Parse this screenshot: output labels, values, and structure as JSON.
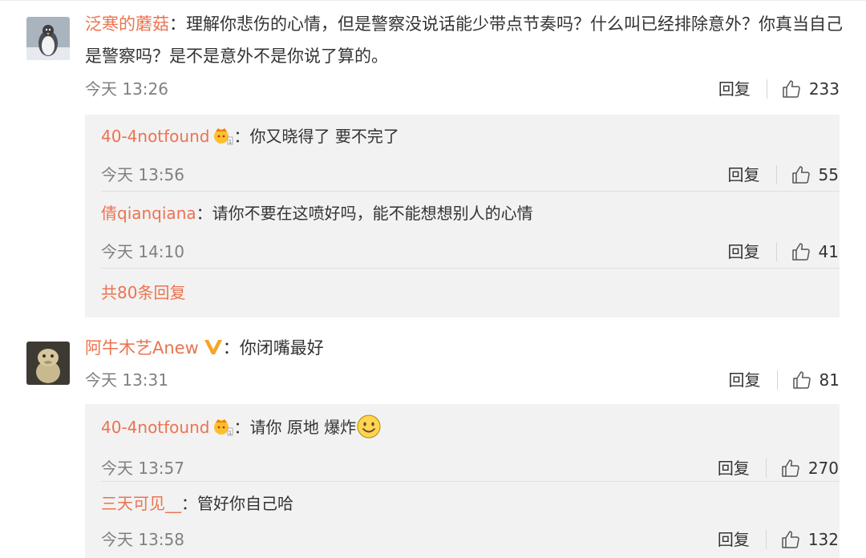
{
  "comments": [
    {
      "user": "泛寒的蘑菇",
      "text": "理解你悲伤的心情，但是警察没说话能少带点节奏吗？什么叫已经排除意外？你真当自己是警察吗？是不是意外不是你说了算的。",
      "time": "今天 13:26",
      "reply_label": "回复",
      "likes": "233",
      "replies": [
        {
          "user": "40-4notfound",
          "text": "你又晓得了 要不完了",
          "time": "今天 13:56",
          "reply_label": "回复",
          "likes": "55"
        },
        {
          "user": "倩qianqiana",
          "text": "请你不要在这喷好吗，能不能想想别人的心情",
          "time": "今天 14:10",
          "reply_label": "回复",
          "likes": "41"
        }
      ],
      "more_replies": "共80条回复"
    },
    {
      "user": "阿牛木艺Anew",
      "text": "你闭嘴最好",
      "time": "今天 13:31",
      "reply_label": "回复",
      "likes": "81",
      "replies": [
        {
          "user": "40-4notfound",
          "text": "请你 原地 爆炸",
          "time": "今天 13:57",
          "reply_label": "回复",
          "likes": "270"
        },
        {
          "user": "三天可见__",
          "text": "管好你自己哈",
          "time": "今天 13:58",
          "reply_label": "回复",
          "likes": "132"
        }
      ]
    }
  ],
  "colors": {
    "username": "#eb7350",
    "time": "#808080",
    "reply_bg": "#f2f2f2",
    "verified": "#f5a623"
  },
  "icons": {
    "like": "thumbs-up-icon",
    "badge": "member-crown-icon",
    "verified": "verified-v-icon",
    "emoji": "smile-emoji-icon"
  },
  "separator": "："
}
